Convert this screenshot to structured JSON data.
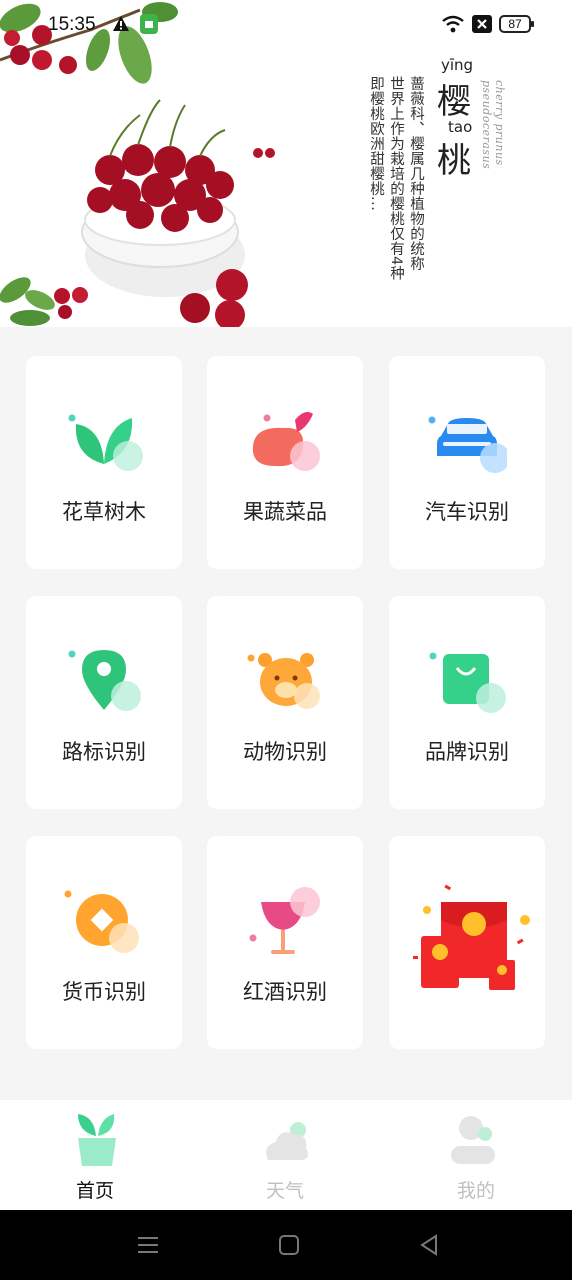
{
  "status_bar": {
    "time": "15:35",
    "battery": "87"
  },
  "banner": {
    "pinyin_1": "yīng",
    "char_1": "樱",
    "pinyin_2": "tao",
    "char_2": "桃",
    "latin": "cherry prunus pseudocerasus",
    "desc_col_1": "蔷薇科、樱属几种植物的统称",
    "desc_col_2": "世界上作为栽培的樱桃仅有4种",
    "desc_col_3": "即樱桃欧洲甜樱桃..."
  },
  "grid": [
    {
      "label": "花草树木",
      "icon": "leaf-icon"
    },
    {
      "label": "果蔬菜品",
      "icon": "eggplant-icon"
    },
    {
      "label": "汽车识别",
      "icon": "car-icon"
    },
    {
      "label": "路标识别",
      "icon": "location-pin-icon"
    },
    {
      "label": "动物识别",
      "icon": "bear-icon"
    },
    {
      "label": "品牌识别",
      "icon": "shopping-bag-icon"
    },
    {
      "label": "货币识别",
      "icon": "coin-icon"
    },
    {
      "label": "红酒识别",
      "icon": "wine-glass-icon"
    },
    {
      "label": "",
      "icon": "red-envelope-icon"
    }
  ],
  "bottom_nav": {
    "items": [
      {
        "label": "首页",
        "icon": "home-plant-icon",
        "active": true
      },
      {
        "label": "天气",
        "icon": "cloud-icon",
        "active": false
      },
      {
        "label": "我的",
        "icon": "user-icon",
        "active": false
      }
    ]
  },
  "colors": {
    "accent_green": "#3ad08f",
    "cherry_red": "#b3142a",
    "inactive": "#c9c9c9"
  }
}
